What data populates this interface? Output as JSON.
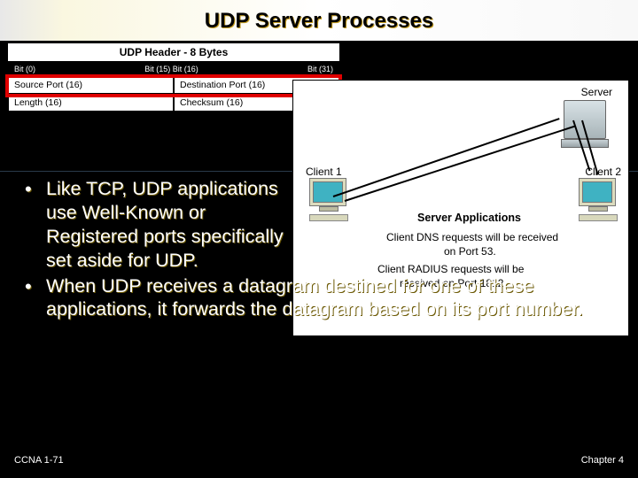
{
  "title": "UDP Server Processes",
  "udp_header": {
    "caption": "UDP Header - 8 Bytes",
    "bits_left": "Bit (0)",
    "bits_mid": "Bit (15) Bit (16)",
    "bits_right": "Bit (31)",
    "row1": {
      "left": "Source Port (16)",
      "right": "Destination Port (16)"
    },
    "row2": {
      "left": "Length (16)",
      "right": "Checksum (16)"
    }
  },
  "diagram": {
    "server": "Server",
    "client1": "Client 1",
    "client2": "Client 2",
    "apps_title": "Server Applications",
    "dns_l1": "Client DNS requests will be received",
    "dns_l2": "on Port 53.",
    "radius_l1": "Client RADIUS requests will be",
    "radius_l2": "received on Port 1812."
  },
  "bullets": {
    "b1": "Like TCP, UDP applications use Well-Known or Registered ports specifically set aside for UDP.",
    "b2": "When UDP receives a datagram destined for one of these applications, it forwards the datagram based on its port number."
  },
  "footer": {
    "left": "CCNA 1-71",
    "right": "Chapter 4"
  }
}
